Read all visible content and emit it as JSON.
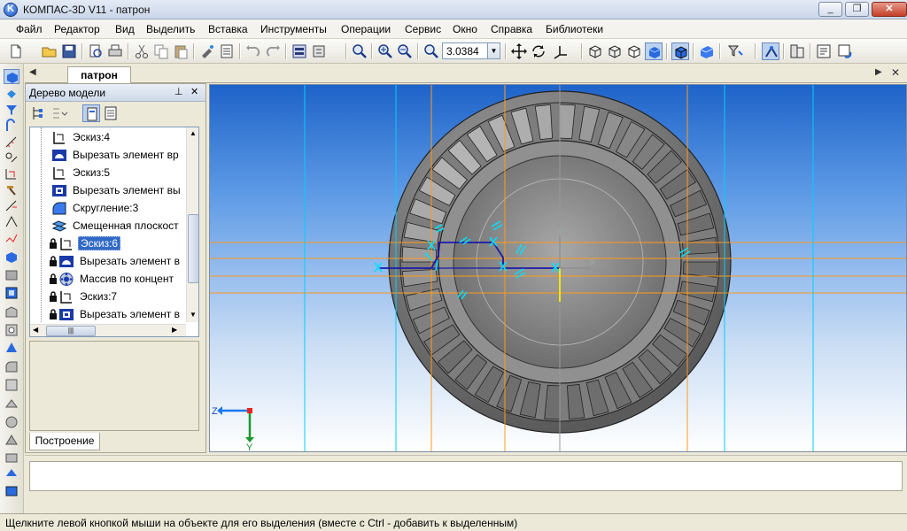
{
  "window": {
    "title": "КОМПАС-3D V11 - патрон",
    "controls": {
      "minimize": "_",
      "restore": "❐",
      "close": "✕"
    }
  },
  "menu": [
    "Файл",
    "Редактор",
    "Вид",
    "Выделить",
    "Вставка",
    "Инструменты",
    "Операции",
    "Сервис",
    "Окно",
    "Справка",
    "Библиотеки"
  ],
  "toolbar": {
    "zoom_value": "3.0384",
    "icons": [
      "new-file-icon",
      "open-file-icon",
      "save-icon",
      "print-preview-icon",
      "print-icon",
      "cut-icon",
      "copy-icon",
      "paste-icon",
      "format-painter-icon",
      "properties-icon",
      "undo-icon",
      "redo-icon",
      "manager-icon",
      "tree-icon",
      "zoom-window-icon",
      "zoom-in-icon",
      "zoom-out-icon",
      "zoom-scale-icon",
      "pan-icon",
      "rotate-icon",
      "orientation-icon",
      "wireframe-icon",
      "hidden-lines-icon",
      "shaded-icon",
      "shaded-edges-icon",
      "perspective-icon",
      "filter-icon",
      "snap-icon",
      "variables-icon",
      "rebuild-icon"
    ]
  },
  "document": {
    "tab_label": "патрон"
  },
  "tree": {
    "title": "Дерево модели",
    "items": [
      {
        "label": "Эскиз:4",
        "icon": "sketch-icon",
        "locked": false,
        "selected": false
      },
      {
        "label": "Вырезать элемент вр",
        "icon": "cut-rotation-icon",
        "locked": false,
        "selected": false
      },
      {
        "label": "Эскиз:5",
        "icon": "sketch-icon",
        "locked": false,
        "selected": false
      },
      {
        "label": "Вырезать элемент вы",
        "icon": "cut-extrusion-icon",
        "locked": false,
        "selected": false
      },
      {
        "label": "Скругление:3",
        "icon": "fillet-icon",
        "locked": false,
        "selected": false
      },
      {
        "label": "Смещенная плоскост",
        "icon": "offset-plane-icon",
        "locked": false,
        "selected": false
      },
      {
        "label": "Эскиз:6",
        "icon": "sketch-icon",
        "locked": true,
        "selected": true
      },
      {
        "label": "Вырезать элемент в",
        "icon": "cut-rotation-icon",
        "locked": true,
        "selected": false
      },
      {
        "label": "Массив по концент",
        "icon": "circular-array-icon",
        "locked": true,
        "selected": false
      },
      {
        "label": "Эскиз:7",
        "icon": "sketch-icon",
        "locked": true,
        "selected": false
      },
      {
        "label": "Вырезать элемент в",
        "icon": "cut-extrusion-icon",
        "locked": true,
        "selected": false
      }
    ],
    "bottom_tab": "Построение"
  },
  "viewport": {
    "axis_labels": {
      "z": "Z",
      "y": "Y",
      "x": "X"
    },
    "colors": {
      "guide_line": "#ff9a1a",
      "sketch_line": "#1a1aa8",
      "constraint": "#00e0ff",
      "body": "#8a8a8a"
    }
  },
  "status": {
    "text": "Щелкните левой кнопкой мыши на объекте для его выделения (вместе с Ctrl - добавить к выделенным)"
  }
}
